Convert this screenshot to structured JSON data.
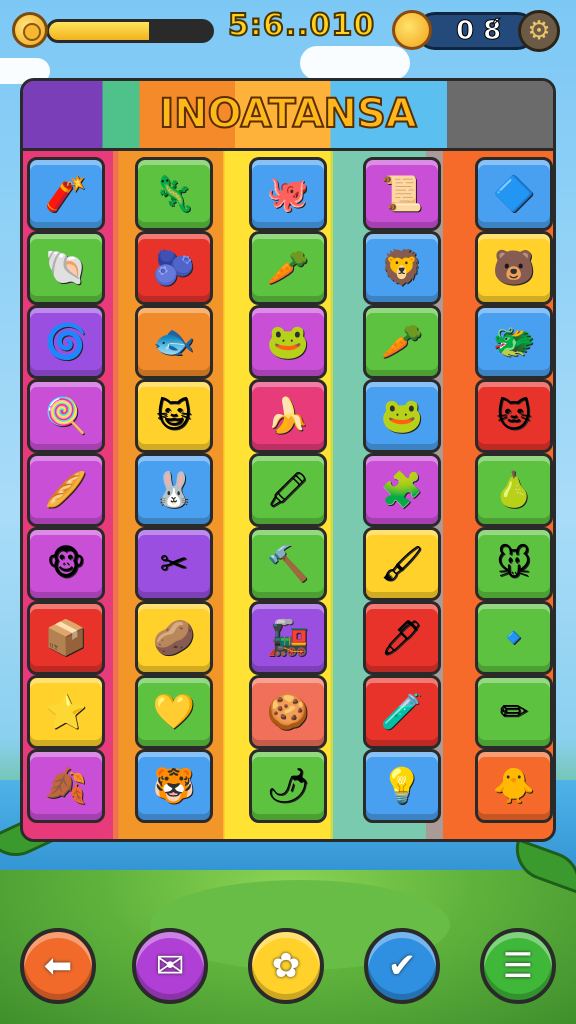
{
  "hud": {
    "score": "5:6..010",
    "lives": "0 8́",
    "progress": 0.62,
    "coin_icon": "coin-icon",
    "sun_icon": "sun-icon",
    "settings_icon": "gear-icon"
  },
  "board": {
    "title": "INOATANSA",
    "tiles": [
      {
        "row": 0,
        "col": 0,
        "color": "#4aa0f0",
        "glyph": "🧨",
        "icon": "firecracker-icon"
      },
      {
        "row": 0,
        "col": 1,
        "color": "#5cc23f",
        "glyph": "🦎",
        "icon": "lizard-icon"
      },
      {
        "row": 0,
        "col": 2,
        "color": "#4aa0f0",
        "glyph": "🐙",
        "icon": "octopus-icon"
      },
      {
        "row": 0,
        "col": 3,
        "color": "#c84fd6",
        "glyph": "📜",
        "icon": "scroll-icon"
      },
      {
        "row": 0,
        "col": 4,
        "color": "#4aa0f0",
        "glyph": "🔷",
        "icon": "crystal-icon"
      },
      {
        "row": 1,
        "col": 0,
        "color": "#5cc23f",
        "glyph": "🐚",
        "icon": "shell-icon"
      },
      {
        "row": 1,
        "col": 1,
        "color": "#e8332a",
        "glyph": "🫐",
        "icon": "blue-drop-icon"
      },
      {
        "row": 1,
        "col": 2,
        "color": "#5cc23f",
        "glyph": "🥕",
        "icon": "root-icon"
      },
      {
        "row": 1,
        "col": 3,
        "color": "#4aa0f0",
        "glyph": "🦁",
        "icon": "lion-icon"
      },
      {
        "row": 1,
        "col": 4,
        "color": "#ffd12a",
        "glyph": "🐻",
        "icon": "bear-icon"
      },
      {
        "row": 2,
        "col": 0,
        "color": "#9a4fe0",
        "glyph": "🌀",
        "icon": "spiral-shell-icon"
      },
      {
        "row": 2,
        "col": 1,
        "color": "#f08a2a",
        "glyph": "🐟",
        "icon": "fish-icon"
      },
      {
        "row": 2,
        "col": 2,
        "color": "#c84fd6",
        "glyph": "🐸",
        "icon": "frog-icon"
      },
      {
        "row": 2,
        "col": 3,
        "color": "#5cc23f",
        "glyph": "🥕",
        "icon": "carrot-icon"
      },
      {
        "row": 2,
        "col": 4,
        "color": "#4aa0f0",
        "glyph": "🐲",
        "icon": "dragon-icon"
      },
      {
        "row": 3,
        "col": 0,
        "color": "#c84fd6",
        "glyph": "🍭",
        "icon": "lollipop-icon"
      },
      {
        "row": 3,
        "col": 1,
        "color": "#ffd12a",
        "glyph": "😺",
        "icon": "cat-face-icon"
      },
      {
        "row": 3,
        "col": 2,
        "color": "#e83b7a",
        "glyph": "🍌",
        "icon": "banana-icon"
      },
      {
        "row": 3,
        "col": 3,
        "color": "#4aa0f0",
        "glyph": "🐸",
        "icon": "blue-frog-icon"
      },
      {
        "row": 3,
        "col": 4,
        "color": "#e8332a",
        "glyph": "🐱",
        "icon": "white-cat-icon"
      },
      {
        "row": 4,
        "col": 0,
        "color": "#c84fd6",
        "glyph": "🥖",
        "icon": "baguette-icon"
      },
      {
        "row": 4,
        "col": 1,
        "color": "#4aa0f0",
        "glyph": "🐰",
        "icon": "rabbit-icon"
      },
      {
        "row": 4,
        "col": 2,
        "color": "#5cc23f",
        "glyph": "🖍",
        "icon": "crayon-icon"
      },
      {
        "row": 4,
        "col": 3,
        "color": "#c84fd6",
        "glyph": "🧩",
        "icon": "puzzle-blob-icon"
      },
      {
        "row": 4,
        "col": 4,
        "color": "#5cc23f",
        "glyph": "🍐",
        "icon": "pear-icon"
      },
      {
        "row": 5,
        "col": 0,
        "color": "#c84fd6",
        "glyph": "🐵",
        "icon": "monkey-icon"
      },
      {
        "row": 5,
        "col": 1,
        "color": "#9a4fe0",
        "glyph": "✂",
        "icon": "scissors-icon"
      },
      {
        "row": 5,
        "col": 2,
        "color": "#5cc23f",
        "glyph": "🔨",
        "icon": "hammer-icon"
      },
      {
        "row": 5,
        "col": 3,
        "color": "#ffd12a",
        "glyph": "🖌",
        "icon": "paintbrush-icon"
      },
      {
        "row": 5,
        "col": 4,
        "color": "#5cc23f",
        "glyph": "🐭",
        "icon": "mouse-icon"
      },
      {
        "row": 6,
        "col": 0,
        "color": "#e8332a",
        "glyph": "📦",
        "icon": "chest-icon"
      },
      {
        "row": 6,
        "col": 1,
        "color": "#ffd12a",
        "glyph": "🥔",
        "icon": "potato-icon"
      },
      {
        "row": 6,
        "col": 2,
        "color": "#9a4fe0",
        "glyph": "🚂",
        "icon": "train-icon"
      },
      {
        "row": 6,
        "col": 3,
        "color": "#e8332a",
        "glyph": "🖊",
        "icon": "pen-icon"
      },
      {
        "row": 6,
        "col": 4,
        "color": "#5cc23f",
        "glyph": "🔹",
        "icon": "diamond-icon"
      },
      {
        "row": 7,
        "col": 0,
        "color": "#ffd12a",
        "glyph": "⭐",
        "icon": "star-icon"
      },
      {
        "row": 7,
        "col": 1,
        "color": "#5cc23f",
        "glyph": "💛",
        "icon": "heart-icon"
      },
      {
        "row": 7,
        "col": 2,
        "color": "#f0705a",
        "glyph": "🍪",
        "icon": "cookie-icon"
      },
      {
        "row": 7,
        "col": 3,
        "color": "#e8332a",
        "glyph": "🧪",
        "icon": "test-tube-icon"
      },
      {
        "row": 7,
        "col": 4,
        "color": "#5cc23f",
        "glyph": "✏",
        "icon": "pencil-icon"
      },
      {
        "row": 8,
        "col": 0,
        "color": "#c84fd6",
        "glyph": "🍂",
        "icon": "leaf-icon"
      },
      {
        "row": 8,
        "col": 1,
        "color": "#4aa0f0",
        "glyph": "🐯",
        "icon": "tiger-icon"
      },
      {
        "row": 8,
        "col": 2,
        "color": "#5cc23f",
        "glyph": "🌶",
        "icon": "chili-icon"
      },
      {
        "row": 8,
        "col": 3,
        "color": "#4aa0f0",
        "glyph": "💡",
        "icon": "bulb-icon"
      },
      {
        "row": 8,
        "col": 4,
        "color": "#f56a2a",
        "glyph": "🐥",
        "icon": "chick-icon"
      }
    ]
  },
  "buttons": [
    {
      "name": "back-button",
      "icon": "arrow-left-icon",
      "glyph": "⬅",
      "color": "#f26a2a"
    },
    {
      "name": "mail-button",
      "icon": "envelope-icon",
      "glyph": "✉",
      "color": "#b03fd6"
    },
    {
      "name": "hint-button",
      "icon": "flower-icon",
      "glyph": "✿",
      "color": "#ffd12a"
    },
    {
      "name": "confirm-button",
      "icon": "checkmark-icon",
      "glyph": "✔",
      "color": "#2f8fe0"
    },
    {
      "name": "menu-button",
      "icon": "menu-icon",
      "glyph": "☰",
      "color": "#3fb83a"
    }
  ]
}
